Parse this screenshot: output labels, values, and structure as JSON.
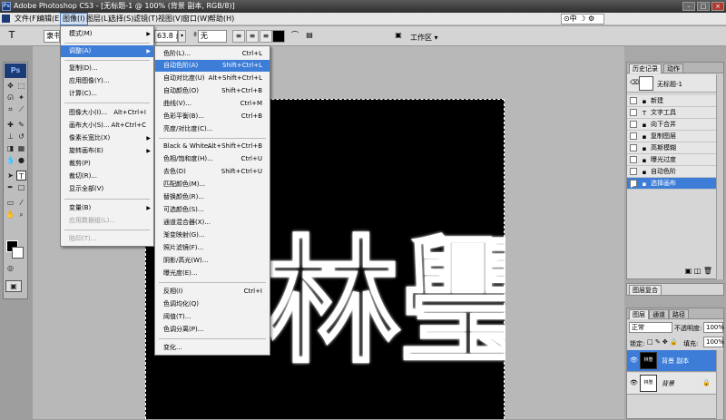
{
  "window": {
    "title": "Adobe Photoshop CS3 - [无标题-1 @ 100% (背景 副本, RGB/8)]",
    "app_icon": "Ps"
  },
  "menubar": {
    "items": [
      "文件(F)",
      "编辑(E)",
      "图像(I)",
      "图层(L)",
      "选择(S)",
      "滤镜(T)",
      "视图(V)",
      "窗口(W)",
      "帮助(H)"
    ],
    "active_index": 2
  },
  "options_bar": {
    "tool_icon": "T",
    "font_family": "隶书",
    "font_size": "63.8 点",
    "antialias": "无",
    "workspace": "工作区 ▾"
  },
  "toolbox": {
    "logo": "Ps"
  },
  "image_menu": {
    "items": [
      {
        "label": "模式(M)",
        "shortcut": "",
        "submenu": true
      },
      {
        "label": "调整(A)",
        "shortcut": "",
        "submenu": true,
        "highlight": true
      },
      {
        "label": "复制(D)...",
        "shortcut": ""
      },
      {
        "label": "应用图像(Y)...",
        "shortcut": ""
      },
      {
        "label": "计算(C)...",
        "shortcut": ""
      },
      {
        "label": "图像大小(I)...",
        "shortcut": "Alt+Ctrl+I"
      },
      {
        "label": "画布大小(S)...",
        "shortcut": "Alt+Ctrl+C"
      },
      {
        "label": "像素长宽比(X)",
        "shortcut": "",
        "submenu": true
      },
      {
        "label": "旋转画布(E)",
        "shortcut": "",
        "submenu": true
      },
      {
        "label": "裁剪(P)",
        "shortcut": ""
      },
      {
        "label": "裁切(R)...",
        "shortcut": ""
      },
      {
        "label": "显示全部(V)",
        "shortcut": ""
      },
      {
        "label": "变量(B)",
        "shortcut": "",
        "submenu": true
      },
      {
        "label": "应用数据组(L)...",
        "shortcut": "",
        "disabled": true
      },
      {
        "label": "陷印(T)...",
        "shortcut": "",
        "disabled": true
      }
    ]
  },
  "adjust_menu": {
    "items": [
      {
        "label": "色阶(L)...",
        "shortcut": "Ctrl+L"
      },
      {
        "label": "自动色阶(A)",
        "shortcut": "Shift+Ctrl+L",
        "highlight": true
      },
      {
        "label": "自动对比度(U)",
        "shortcut": "Alt+Shift+Ctrl+L"
      },
      {
        "label": "自动颜色(O)",
        "shortcut": "Shift+Ctrl+B"
      },
      {
        "label": "曲线(V)...",
        "shortcut": "Ctrl+M"
      },
      {
        "label": "色彩平衡(B)...",
        "shortcut": "Ctrl+B"
      },
      {
        "label": "亮度/对比度(C)...",
        "shortcut": ""
      },
      {
        "label": "Black & White...",
        "shortcut": "Alt+Shift+Ctrl+B"
      },
      {
        "label": "色相/饱和度(H)...",
        "shortcut": "Ctrl+U"
      },
      {
        "label": "去色(D)",
        "shortcut": "Shift+Ctrl+U"
      },
      {
        "label": "匹配颜色(M)...",
        "shortcut": ""
      },
      {
        "label": "替换颜色(R)...",
        "shortcut": ""
      },
      {
        "label": "可选颜色(S)...",
        "shortcut": ""
      },
      {
        "label": "通道混合器(X)...",
        "shortcut": ""
      },
      {
        "label": "渐变映射(G)...",
        "shortcut": ""
      },
      {
        "label": "照片滤镜(F)...",
        "shortcut": ""
      },
      {
        "label": "阴影/高光(W)...",
        "shortcut": ""
      },
      {
        "label": "曝光度(E)...",
        "shortcut": ""
      },
      {
        "label": "反相(I)",
        "shortcut": "Ctrl+I"
      },
      {
        "label": "色调均化(Q)",
        "shortcut": ""
      },
      {
        "label": "阈值(T)...",
        "shortcut": ""
      },
      {
        "label": "色调分离(P)...",
        "shortcut": ""
      },
      {
        "label": "变化...",
        "shortcut": ""
      }
    ]
  },
  "canvas": {
    "text": "林璺"
  },
  "history_panel": {
    "tabs": [
      "历史记录",
      "动作"
    ],
    "snapshot": "无标题-1",
    "steps": [
      "新建",
      "文字工具",
      "向下合并",
      "复制图层",
      "高斯模糊",
      "曝光过度",
      "自动色阶",
      "选择画布"
    ],
    "selected_index": 7
  },
  "layers_panel": {
    "tabs": [
      "图层",
      "通道",
      "路径"
    ],
    "blend_mode": "正常",
    "opacity_label": "不透明度:",
    "opacity": "100%",
    "lock_label": "锁定:",
    "fill_label": "填充:",
    "fill": "100%",
    "layers": [
      {
        "name": "背景 副本",
        "thumb": "林璺",
        "selected": true
      },
      {
        "name": "背景",
        "thumb": "林璺",
        "selected": false
      }
    ]
  },
  "layer_comps_panel": {
    "tab": "图层复合"
  },
  "colors": {
    "menu_highlight": "#3d7dd8",
    "canvas_bg": "#000000",
    "glow_stroke": "#ffffff"
  }
}
